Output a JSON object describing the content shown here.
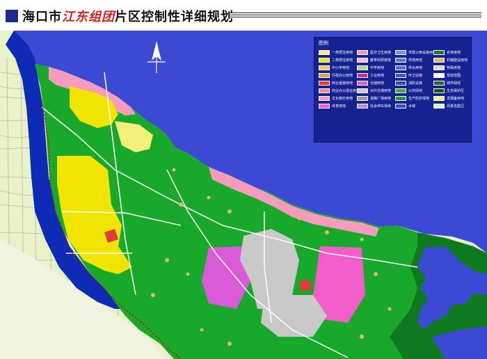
{
  "header": {
    "title_prefix": "海口市",
    "title_highlight": "江东组团",
    "title_suffix": "片区控制性详细规划"
  },
  "legend": {
    "title": "图例",
    "items": [
      {
        "label": "一类居住用地",
        "color": "#f5f07a"
      },
      {
        "label": "二类居住用地",
        "color": "#f0e400"
      },
      {
        "label": "中小学用地",
        "color": "#f7c84a"
      },
      {
        "label": "行政办公用地",
        "color": "#e8a33a"
      },
      {
        "label": "商业金融用地",
        "color": "#e23b3b"
      },
      {
        "label": "商业办公混合用地",
        "color": "#f08b8b"
      },
      {
        "label": "文化娱乐用地",
        "color": "#f59cbc"
      },
      {
        "label": "体育用地",
        "color": "#f15ec9"
      },
      {
        "label": "医疗卫生用地",
        "color": "#f29bb0"
      },
      {
        "label": "教育科研用地",
        "color": "#f6b8d8"
      },
      {
        "label": "中学用地",
        "color": "#a7e06f"
      },
      {
        "label": "工业用地",
        "color": "#c52ab0"
      },
      {
        "label": "仓储用地",
        "color": "#d95bd9"
      },
      {
        "label": "对外交通用地",
        "color": "#c9c9c9"
      },
      {
        "label": "道路广场用地",
        "color": "#9c9c9c"
      },
      {
        "label": "社会停车场库",
        "color": "#b68be6"
      },
      {
        "label": "市政公用设施用地",
        "color": "#7f92d9"
      },
      {
        "label": "供电用地",
        "color": "#5a78c8"
      },
      {
        "label": "供水用地",
        "color": "#4d6fd0"
      },
      {
        "label": "环卫设施",
        "color": "#3f5bb5"
      },
      {
        "label": "消防设施",
        "color": "#2f4aa8"
      },
      {
        "label": "公共绿地",
        "color": "#2fb43a"
      },
      {
        "label": "生产防护绿地",
        "color": "#23963a"
      },
      {
        "label": "水域",
        "color": "#3b49d3"
      },
      {
        "label": "农林用地",
        "color": "#1a7c2c"
      },
      {
        "label": "村镇建设用地",
        "color": "#e3b86a"
      },
      {
        "label": "特殊用地",
        "color": "#d9d9d9"
      },
      {
        "label": "规划范围",
        "color": "#ffffff"
      },
      {
        "label": "城市绿线",
        "color": "#1d6b2a"
      },
      {
        "label": "生态保护区",
        "color": "#0e5b1e"
      },
      {
        "label": "发展备用地",
        "color": "#f5f07a"
      },
      {
        "label": "风景名胜区",
        "color": "#c9f7ee"
      }
    ]
  },
  "colors": {
    "sea": "#3b49d3",
    "land_base": "#e6f4c5",
    "green": "#18a92b",
    "dark_green": "#0e7a20",
    "river": "#0d2bb5"
  }
}
